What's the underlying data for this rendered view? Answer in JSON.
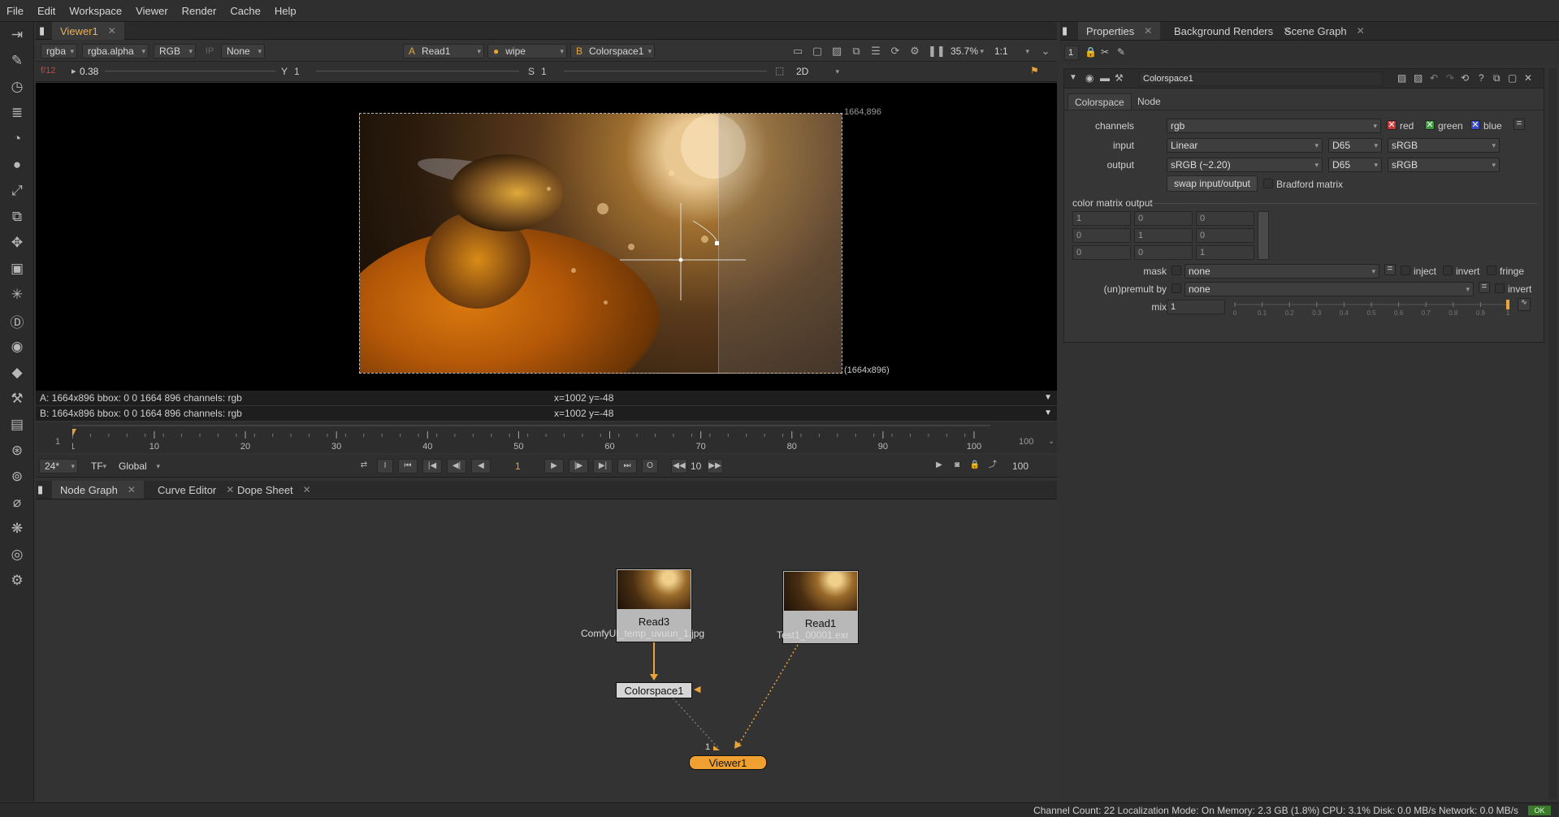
{
  "menu": [
    "File",
    "Edit",
    "Workspace",
    "Viewer",
    "Render",
    "Cache",
    "Help"
  ],
  "viewer": {
    "tab": "Viewer1",
    "channels": "rgba",
    "alpha": "rgba.alpha",
    "colorspace": "RGB",
    "ip": "IP",
    "lut": "None",
    "input_a_prefix": "A",
    "input_a": "Read1",
    "wipe": "wipe",
    "input_b_prefix": "B",
    "input_b": "Colorspace1",
    "zoom": "35.7%",
    "ratio": "1:1",
    "frame_display": "f/12",
    "gain": "0.38",
    "y_label": "Y",
    "y_value": "1",
    "s_label": "S",
    "s_value": "1",
    "mode": "2D",
    "format_top": "1664,896",
    "format_bottom": "(1664x896)",
    "info_a": "A:  1664x896  bbox: 0 0 1664 896 channels: rgb",
    "info_b": "B:  1664x896  bbox: 0 0 1664 896 channels: rgb",
    "coords_a": "x=1002 y=-48",
    "coords_b": "x=1002 y=-48"
  },
  "timeline": {
    "start": "1",
    "end": "100",
    "ticks": [
      "1",
      "10",
      "20",
      "30",
      "40",
      "50",
      "60",
      "70",
      "80",
      "90",
      "100"
    ],
    "current_frame": "1",
    "fps": "24*",
    "tf": "TF",
    "scope": "Global",
    "step": "10",
    "end_frame": "100",
    "playhead_frame": "1"
  },
  "node_graph": {
    "tabs": [
      "Node Graph",
      "Curve Editor",
      "Dope Sheet"
    ],
    "nodes": {
      "read3": {
        "name": "Read3",
        "file": "ComfyUI_temp_uvuun_1.jpg"
      },
      "read1": {
        "name": "Read1",
        "file": "Test1_00001.exr"
      },
      "colorspace": {
        "name": "Colorspace1"
      },
      "viewer": {
        "name": "Viewer1",
        "input_label": "1"
      }
    }
  },
  "properties": {
    "tabs": [
      "Properties",
      "Background Renders",
      "Scene Graph"
    ],
    "count": "1",
    "node_name": "Colorspace1",
    "subtabs": [
      "Colorspace",
      "Node"
    ],
    "channels_label": "channels",
    "channels_value": "rgb",
    "red": "red",
    "green": "green",
    "blue": "blue",
    "input_label": "input",
    "input_value": "Linear",
    "input_illum": "D65",
    "input_primaries": "sRGB",
    "output_label": "output",
    "output_value": "sRGB (~2.20)",
    "output_illum": "D65",
    "output_primaries": "sRGB",
    "swap_button": "swap input/output",
    "bradford": "Bradford matrix",
    "matrix_title": "color matrix output",
    "matrix": [
      [
        "1",
        "0",
        "0"
      ],
      [
        "0",
        "1",
        "0"
      ],
      [
        "0",
        "0",
        "1"
      ]
    ],
    "mask_label": "mask",
    "mask_value": "none",
    "inject": "inject",
    "invert": "invert",
    "fringe": "fringe",
    "premult_label": "(un)premult by",
    "premult_value": "none",
    "premult_invert": "invert",
    "mix_label": "mix",
    "mix_value": "1",
    "mix_ticks": [
      "0",
      "0.1",
      "0.2",
      "0.3",
      "0.4",
      "0.5",
      "0.6",
      "0.7",
      "0.8",
      "0.9",
      "1"
    ]
  },
  "status": {
    "text": "Channel Count: 22 Localization Mode: On Memory: 2.3 GB (1.8%) CPU: 3.1% Disk: 0.0 MB/s Network: 0.0 MB/s",
    "ok": "OK"
  },
  "colors": {
    "accent": "#e8a33a",
    "viewer_node": "#f0a030",
    "red_check": "#c83a3a",
    "green_check": "#3a9a3a",
    "blue_check": "#3a4ac8"
  },
  "icons": [
    "viewer-icon",
    "paint-icon",
    "time-icon",
    "channel-icon",
    "color-icon",
    "filter-icon",
    "keyer-icon",
    "merge-icon",
    "transform-icon",
    "3d-icon",
    "particles-icon",
    "deep-icon",
    "views-icon",
    "metadata-icon",
    "toolsets-icon",
    "other-icon",
    "furnace-icon",
    "gizmo-icon"
  ]
}
